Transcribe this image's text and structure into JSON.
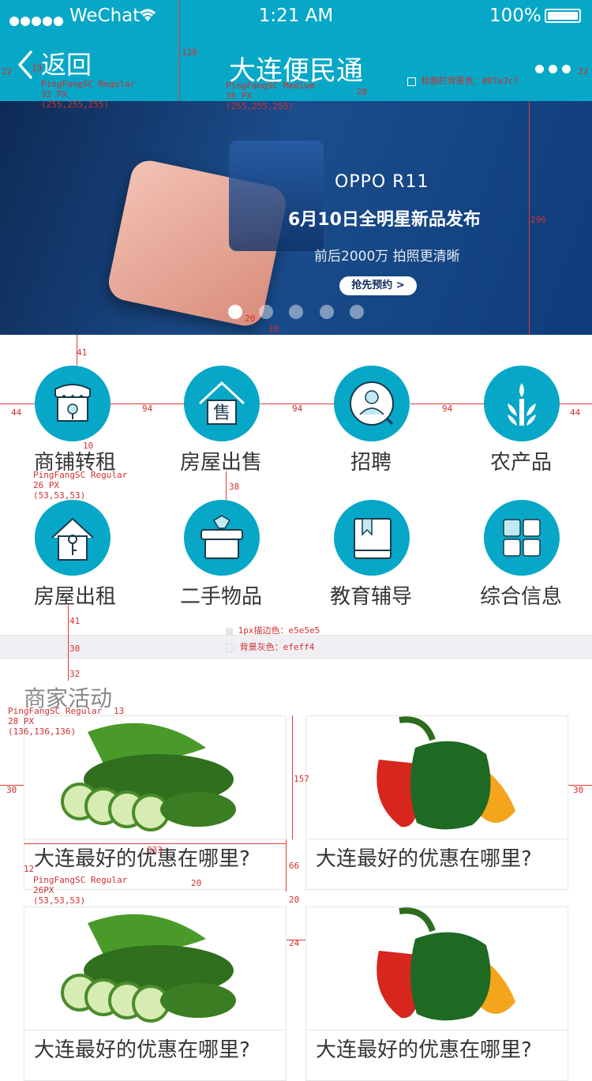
{
  "status_bar": {
    "signal_carrier": "WeChat",
    "time": "1:21 AM",
    "battery": "100%"
  },
  "nav": {
    "back_label": "返回",
    "title": "大连便民通",
    "more_icon": "more-dots-icon",
    "bg_color": "#07a7c7"
  },
  "banner": {
    "brand": "OPPO R11",
    "headline": "6月10日全明星新品发布",
    "subline": "前后2000万 拍照更清晰",
    "cta": "抢先预约 >",
    "dot_count": 5,
    "active_dot": 1
  },
  "categories": [
    {
      "label": "商铺转租",
      "icon": "shop-icon"
    },
    {
      "label": "房屋出售",
      "icon": "house-sale-icon"
    },
    {
      "label": "招聘",
      "icon": "person-icon"
    },
    {
      "label": "农产品",
      "icon": "wheat-icon"
    },
    {
      "label": "房屋出租",
      "icon": "house-key-icon"
    },
    {
      "label": "二手物品",
      "icon": "box-icon"
    },
    {
      "label": "教育辅导",
      "icon": "book-icon"
    },
    {
      "label": "综合信息",
      "icon": "grid-icon"
    }
  ],
  "section": {
    "title": "商家活动"
  },
  "cards": [
    {
      "title": "大连最好的优惠在哪里?",
      "image": "cucumber-image"
    },
    {
      "title": "大连最好的优惠在哪里?",
      "image": "pepper-image"
    },
    {
      "title": "大连最好的优惠在哪里?",
      "image": "cucumber-image"
    },
    {
      "title": "大连最好的优惠在哪里?",
      "image": "pepper-image"
    }
  ],
  "annotations": {
    "status_height": "128",
    "back_spec": [
      "PingFangSC Regular",
      "32 PX",
      "(255,255,255)"
    ],
    "title_spec": [
      "PingFangSC Medium",
      "36 PX",
      "(255,255,255)"
    ],
    "title_gap": "28",
    "nav_bg_note": "标题栏背景色：#07a7c7",
    "left_pad": "22",
    "back_gap": "10",
    "right_pad": "22",
    "banner_height": "296",
    "dot_gap": "20",
    "dot_size": "18",
    "cat_top": "41",
    "cat_side": "44",
    "cat_gap_1": "94",
    "cat_gap_2": "94",
    "cat_gap_3": "94",
    "cat_side_r": "44",
    "cat_label_gap": "10",
    "cat_label_spec": [
      "PingFangSC Regular",
      "26 PX",
      "(53,53,53)"
    ],
    "cat_row_gap": "38",
    "section_gap_top": "41",
    "divider_h": "30",
    "section_title_gap": "32",
    "border_note": "1px描边色：e5e5e5",
    "bg_note": "背景灰色：efeff4",
    "section_title_spec": [
      "PingFangSC Regular",
      "28 PX",
      "(136,136,136)"
    ],
    "section_title_bottom": "13",
    "card_side": "30",
    "card_img_h": "157",
    "card_width": "333",
    "card_text_left": "12",
    "card_text_h": "66",
    "card_text_spec": [
      "PingFangSC Regular",
      "26PX",
      "(53,53,53)"
    ],
    "card_text_gap": "20",
    "card_row_gap": "20",
    "card_col_gap": "24",
    "card_side_r": "30"
  }
}
